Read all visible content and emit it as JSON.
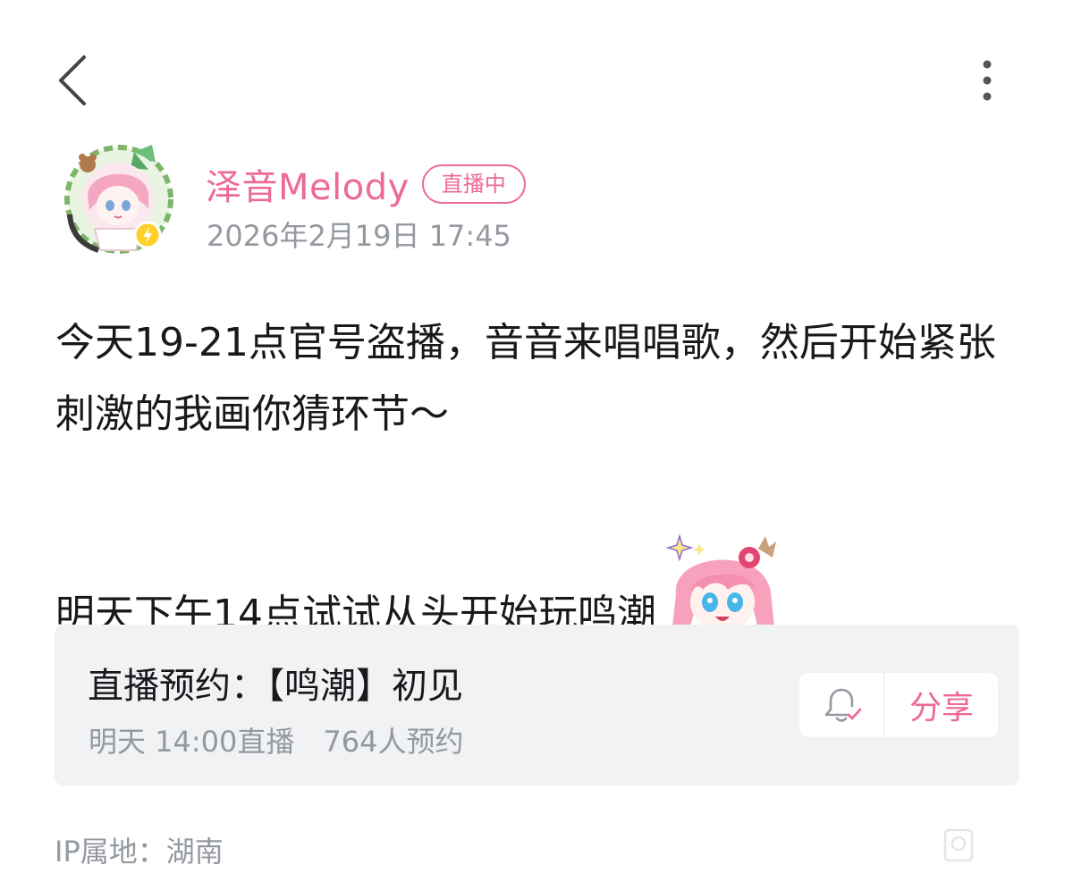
{
  "nav": {
    "back_icon": "chevron-left-icon",
    "more_icon": "more-vertical-icon"
  },
  "author": {
    "name": "泽音Melody",
    "live_badge": "直播中",
    "post_time": "2026年2月19日 17:45",
    "avatar_badge_icon": "lightning-icon"
  },
  "post": {
    "line1": "今天19-21点官号盗播，音音来唱唱歌，然后开始紧张刺激的我画你猜环节～",
    "line2": "明天下午14点试试从头开始玩鸣潮"
  },
  "reservation": {
    "title": "直播预约：【鸣潮】初见",
    "time": "明天 14:00直播",
    "count": "764人预约",
    "remind_icon": "bell-check-icon",
    "share_label": "分享"
  },
  "footer": {
    "ip_location": "IP属地：湖南"
  },
  "colors": {
    "accent": "#ec6a93",
    "secondary_text": "#9499a0",
    "card_bg": "#f1f2f3",
    "primary_text": "#18191c"
  }
}
